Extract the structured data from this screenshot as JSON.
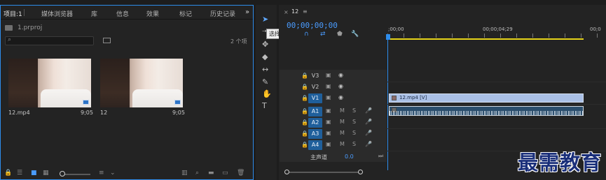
{
  "project": {
    "tabs": [
      "项目:1",
      "媒体浏览器",
      "库",
      "信息",
      "效果",
      "标记",
      "历史记录"
    ],
    "overflow": "»",
    "file": "1.prproj",
    "item_count": "2 个项",
    "clips": [
      {
        "name": "12.mp4",
        "duration": "9;05"
      },
      {
        "name": "12",
        "duration": "9;05"
      }
    ]
  },
  "tools": {
    "tooltip": "选择工具 (V)",
    "icons": [
      "selection-tool-icon",
      "track-select-icon",
      "ripple-edit-icon",
      "razor-icon",
      "slip-icon",
      "pen-icon",
      "hand-icon",
      "type-icon"
    ]
  },
  "timeline": {
    "tab_close": "×",
    "sequence_name": "12",
    "tab_menu": "≡",
    "timecode": "00;00;00;00",
    "ruler": [
      ";00;00",
      "00;00;04;29",
      "00;0"
    ],
    "video_tracks": [
      {
        "label": "V3",
        "active": false
      },
      {
        "label": "V2",
        "active": false
      },
      {
        "label": "V1",
        "active": true
      }
    ],
    "audio_tracks": [
      "A1",
      "A2",
      "A3",
      "A4"
    ],
    "mute": "M",
    "solo": "S",
    "video_clip": "12.mp4 [V]",
    "master_label": "主声道",
    "master_value": "0.0"
  },
  "colors": {
    "accent": "#2d8ceb",
    "timecode": "#4a9cff",
    "work_area": "#e6d319",
    "video_clip": "#aac0e6",
    "audio_clip": "#2b4e6d"
  },
  "watermark": "最需教育"
}
